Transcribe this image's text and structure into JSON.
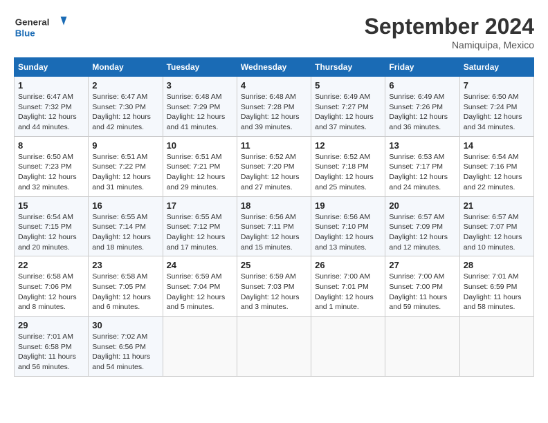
{
  "header": {
    "logo_line1": "General",
    "logo_line2": "Blue",
    "month_title": "September 2024",
    "location": "Namiquipa, Mexico"
  },
  "weekdays": [
    "Sunday",
    "Monday",
    "Tuesday",
    "Wednesday",
    "Thursday",
    "Friday",
    "Saturday"
  ],
  "weeks": [
    [
      {
        "day": "1",
        "sunrise": "Sunrise: 6:47 AM",
        "sunset": "Sunset: 7:32 PM",
        "daylight": "Daylight: 12 hours and 44 minutes."
      },
      {
        "day": "2",
        "sunrise": "Sunrise: 6:47 AM",
        "sunset": "Sunset: 7:30 PM",
        "daylight": "Daylight: 12 hours and 42 minutes."
      },
      {
        "day": "3",
        "sunrise": "Sunrise: 6:48 AM",
        "sunset": "Sunset: 7:29 PM",
        "daylight": "Daylight: 12 hours and 41 minutes."
      },
      {
        "day": "4",
        "sunrise": "Sunrise: 6:48 AM",
        "sunset": "Sunset: 7:28 PM",
        "daylight": "Daylight: 12 hours and 39 minutes."
      },
      {
        "day": "5",
        "sunrise": "Sunrise: 6:49 AM",
        "sunset": "Sunset: 7:27 PM",
        "daylight": "Daylight: 12 hours and 37 minutes."
      },
      {
        "day": "6",
        "sunrise": "Sunrise: 6:49 AM",
        "sunset": "Sunset: 7:26 PM",
        "daylight": "Daylight: 12 hours and 36 minutes."
      },
      {
        "day": "7",
        "sunrise": "Sunrise: 6:50 AM",
        "sunset": "Sunset: 7:24 PM",
        "daylight": "Daylight: 12 hours and 34 minutes."
      }
    ],
    [
      {
        "day": "8",
        "sunrise": "Sunrise: 6:50 AM",
        "sunset": "Sunset: 7:23 PM",
        "daylight": "Daylight: 12 hours and 32 minutes."
      },
      {
        "day": "9",
        "sunrise": "Sunrise: 6:51 AM",
        "sunset": "Sunset: 7:22 PM",
        "daylight": "Daylight: 12 hours and 31 minutes."
      },
      {
        "day": "10",
        "sunrise": "Sunrise: 6:51 AM",
        "sunset": "Sunset: 7:21 PM",
        "daylight": "Daylight: 12 hours and 29 minutes."
      },
      {
        "day": "11",
        "sunrise": "Sunrise: 6:52 AM",
        "sunset": "Sunset: 7:20 PM",
        "daylight": "Daylight: 12 hours and 27 minutes."
      },
      {
        "day": "12",
        "sunrise": "Sunrise: 6:52 AM",
        "sunset": "Sunset: 7:18 PM",
        "daylight": "Daylight: 12 hours and 25 minutes."
      },
      {
        "day": "13",
        "sunrise": "Sunrise: 6:53 AM",
        "sunset": "Sunset: 7:17 PM",
        "daylight": "Daylight: 12 hours and 24 minutes."
      },
      {
        "day": "14",
        "sunrise": "Sunrise: 6:54 AM",
        "sunset": "Sunset: 7:16 PM",
        "daylight": "Daylight: 12 hours and 22 minutes."
      }
    ],
    [
      {
        "day": "15",
        "sunrise": "Sunrise: 6:54 AM",
        "sunset": "Sunset: 7:15 PM",
        "daylight": "Daylight: 12 hours and 20 minutes."
      },
      {
        "day": "16",
        "sunrise": "Sunrise: 6:55 AM",
        "sunset": "Sunset: 7:14 PM",
        "daylight": "Daylight: 12 hours and 18 minutes."
      },
      {
        "day": "17",
        "sunrise": "Sunrise: 6:55 AM",
        "sunset": "Sunset: 7:12 PM",
        "daylight": "Daylight: 12 hours and 17 minutes."
      },
      {
        "day": "18",
        "sunrise": "Sunrise: 6:56 AM",
        "sunset": "Sunset: 7:11 PM",
        "daylight": "Daylight: 12 hours and 15 minutes."
      },
      {
        "day": "19",
        "sunrise": "Sunrise: 6:56 AM",
        "sunset": "Sunset: 7:10 PM",
        "daylight": "Daylight: 12 hours and 13 minutes."
      },
      {
        "day": "20",
        "sunrise": "Sunrise: 6:57 AM",
        "sunset": "Sunset: 7:09 PM",
        "daylight": "Daylight: 12 hours and 12 minutes."
      },
      {
        "day": "21",
        "sunrise": "Sunrise: 6:57 AM",
        "sunset": "Sunset: 7:07 PM",
        "daylight": "Daylight: 12 hours and 10 minutes."
      }
    ],
    [
      {
        "day": "22",
        "sunrise": "Sunrise: 6:58 AM",
        "sunset": "Sunset: 7:06 PM",
        "daylight": "Daylight: 12 hours and 8 minutes."
      },
      {
        "day": "23",
        "sunrise": "Sunrise: 6:58 AM",
        "sunset": "Sunset: 7:05 PM",
        "daylight": "Daylight: 12 hours and 6 minutes."
      },
      {
        "day": "24",
        "sunrise": "Sunrise: 6:59 AM",
        "sunset": "Sunset: 7:04 PM",
        "daylight": "Daylight: 12 hours and 5 minutes."
      },
      {
        "day": "25",
        "sunrise": "Sunrise: 6:59 AM",
        "sunset": "Sunset: 7:03 PM",
        "daylight": "Daylight: 12 hours and 3 minutes."
      },
      {
        "day": "26",
        "sunrise": "Sunrise: 7:00 AM",
        "sunset": "Sunset: 7:01 PM",
        "daylight": "Daylight: 12 hours and 1 minute."
      },
      {
        "day": "27",
        "sunrise": "Sunrise: 7:00 AM",
        "sunset": "Sunset: 7:00 PM",
        "daylight": "Daylight: 11 hours and 59 minutes."
      },
      {
        "day": "28",
        "sunrise": "Sunrise: 7:01 AM",
        "sunset": "Sunset: 6:59 PM",
        "daylight": "Daylight: 11 hours and 58 minutes."
      }
    ],
    [
      {
        "day": "29",
        "sunrise": "Sunrise: 7:01 AM",
        "sunset": "Sunset: 6:58 PM",
        "daylight": "Daylight: 11 hours and 56 minutes."
      },
      {
        "day": "30",
        "sunrise": "Sunrise: 7:02 AM",
        "sunset": "Sunset: 6:56 PM",
        "daylight": "Daylight: 11 hours and 54 minutes."
      },
      null,
      null,
      null,
      null,
      null
    ]
  ]
}
